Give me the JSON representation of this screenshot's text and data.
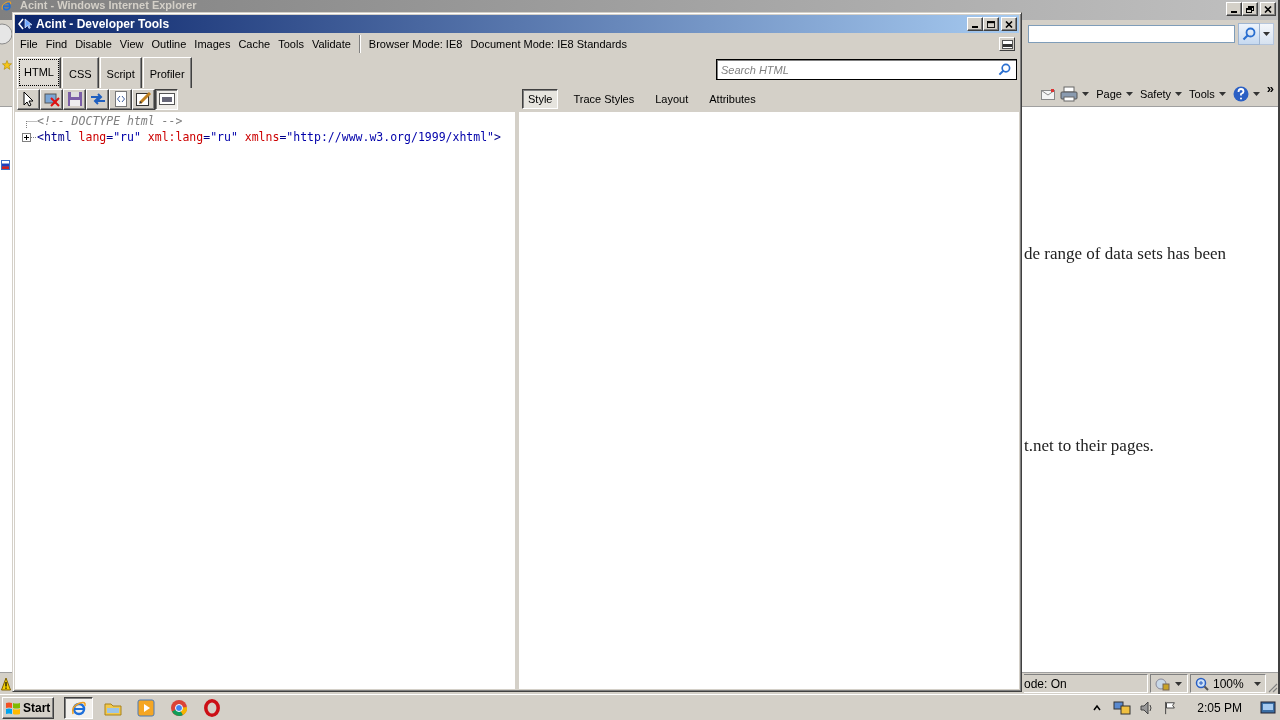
{
  "browser": {
    "title": "Acint - Windows Internet Explorer",
    "command_menus": [
      "Page",
      "Safety",
      "Tools"
    ],
    "more": "»",
    "page_lines": [
      "de range of data sets has been",
      "t.net to their pages."
    ],
    "status_bar": {
      "mode": "ode: On",
      "zoom": "100%"
    }
  },
  "devtools": {
    "title": "Acint - Developer Tools",
    "menu": [
      "File",
      "Find",
      "Disable",
      "View",
      "Outline",
      "Images",
      "Cache",
      "Tools",
      "Validate"
    ],
    "mode_menus": [
      "Browser Mode: IE8",
      "Document Mode: IE8 Standards"
    ],
    "tabs": [
      {
        "label": "HTML",
        "selected": true
      },
      {
        "label": "CSS",
        "selected": false
      },
      {
        "label": "Script",
        "selected": false
      },
      {
        "label": "Profiler",
        "selected": false
      }
    ],
    "search": {
      "placeholder": "Search HTML"
    },
    "toolbar": [
      {
        "on": false
      },
      {
        "on": false
      },
      {
        "on": false
      },
      {
        "on": false
      },
      {
        "on": false
      },
      {
        "on": false
      },
      {
        "on": true
      }
    ],
    "pane_tabs": [
      {
        "label": "Style",
        "selected": true
      },
      {
        "label": "Trace Styles",
        "selected": false
      },
      {
        "label": "Layout",
        "selected": false
      },
      {
        "label": "Attributes",
        "selected": false
      }
    ],
    "tree": [
      {
        "kind": "comment",
        "text": "<!-- DOCTYPE html -->"
      },
      {
        "kind": "element",
        "expanded": false,
        "tokens": [
          {
            "kind": "tag",
            "text": "<html"
          },
          {
            "kind": "attr",
            "text": " lang"
          },
          {
            "kind": "punct",
            "text": "="
          },
          {
            "kind": "value",
            "text": "\"ru\""
          },
          {
            "kind": "attr",
            "text": " xml:lang"
          },
          {
            "kind": "punct",
            "text": "="
          },
          {
            "kind": "value",
            "text": "\"ru\""
          },
          {
            "kind": "attr",
            "text": " xmlns"
          },
          {
            "kind": "punct",
            "text": "="
          },
          {
            "kind": "value",
            "text": "\"http://www.w3.org/1999/xhtml\""
          },
          {
            "kind": "tag",
            "text": ">"
          }
        ]
      }
    ]
  },
  "taskbar": {
    "start": "Start",
    "ie_button": {
      "selected": true
    },
    "clock": "2:05 PM"
  }
}
